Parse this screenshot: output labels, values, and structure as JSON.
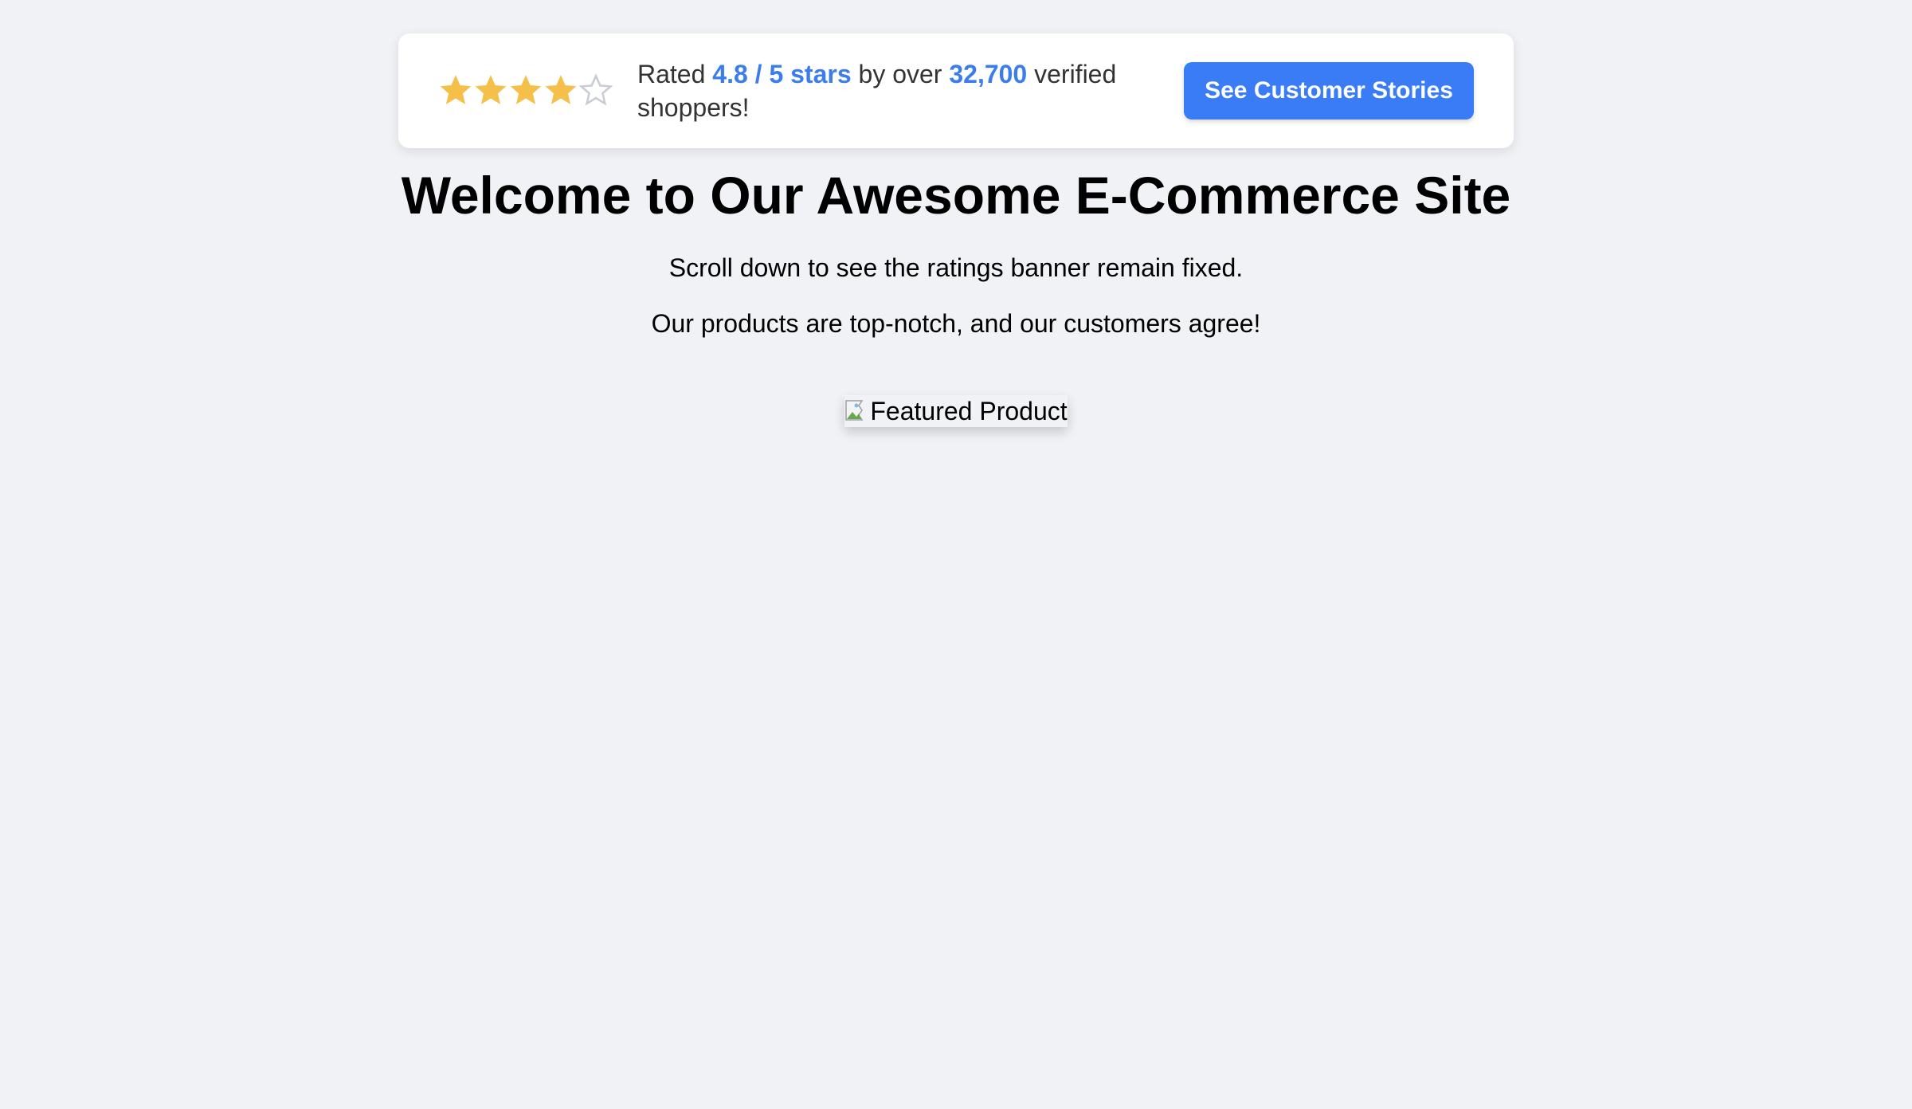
{
  "banner": {
    "rating": {
      "value": 4,
      "max": 5
    },
    "text_prefix": "Rated",
    "rating_highlight": "4.8 / 5 stars",
    "text_middle": "by over",
    "count_highlight": "32,700",
    "text_suffix": "verified shoppers!",
    "cta_label": "See Customer Stories"
  },
  "main": {
    "title": "Welcome to Our Awesome E-Commerce Site",
    "paragraph_1": "Scroll down to see the ratings banner remain fixed.",
    "paragraph_2": "Our products are top-notch, and our customers agree!",
    "featured_image_alt": "Featured Product"
  },
  "colors": {
    "background": "#f0f2f5",
    "accent": "#3b7ded",
    "button": "#3a7cf6",
    "star_filled": "#f5c04a",
    "star_empty": "#c9ccd3"
  },
  "icons": {
    "star": "star-icon",
    "broken_image": "broken-image-icon"
  }
}
